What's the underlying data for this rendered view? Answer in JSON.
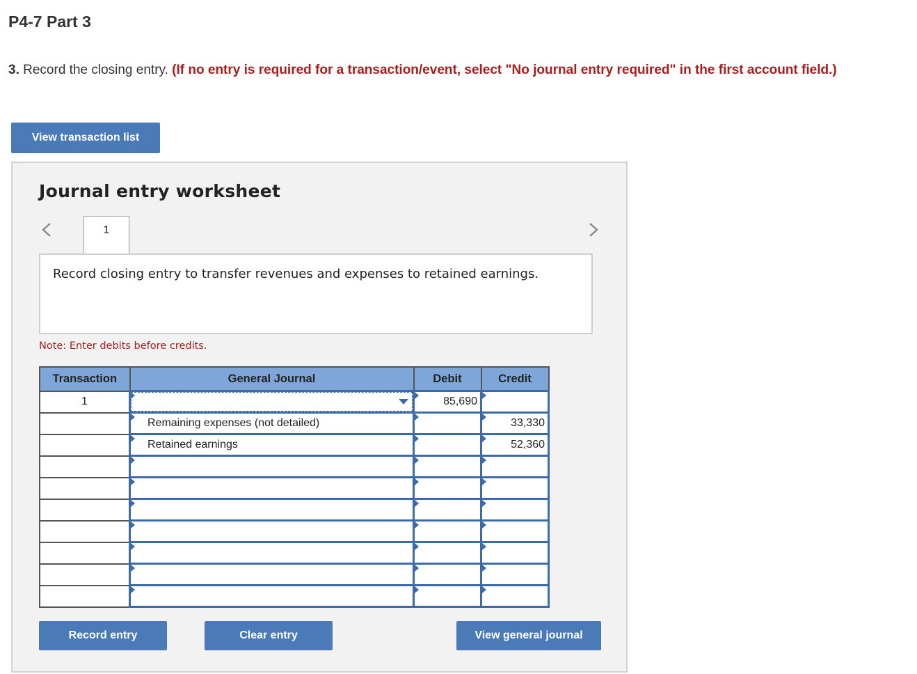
{
  "page": {
    "title": "P4-7 Part 3",
    "instruction_number": "3.",
    "instruction_text": "Record the closing entry.",
    "instruction_highlight": "(If no entry is required for a transaction/event, select \"No journal entry required\" in the first account field.)",
    "view_transaction_list_label": "View transaction list"
  },
  "worksheet": {
    "title": "Journal entry worksheet",
    "current_tab": "1",
    "description": "Record closing entry to transfer revenues and expenses to retained earnings.",
    "note": "Note: Enter debits before credits.",
    "columns": {
      "transaction": "Transaction",
      "general_journal": "General Journal",
      "debit": "Debit",
      "credit": "Credit"
    },
    "rows": [
      {
        "transaction": "1",
        "account": "",
        "debit": "85,690",
        "credit": ""
      },
      {
        "transaction": "",
        "account": "Remaining expenses (not detailed)",
        "debit": "",
        "credit": "33,330"
      },
      {
        "transaction": "",
        "account": "Retained earnings",
        "debit": "",
        "credit": "52,360"
      },
      {
        "transaction": "",
        "account": "",
        "debit": "",
        "credit": ""
      },
      {
        "transaction": "",
        "account": "",
        "debit": "",
        "credit": ""
      },
      {
        "transaction": "",
        "account": "",
        "debit": "",
        "credit": ""
      },
      {
        "transaction": "",
        "account": "",
        "debit": "",
        "credit": ""
      },
      {
        "transaction": "",
        "account": "",
        "debit": "",
        "credit": ""
      },
      {
        "transaction": "",
        "account": "",
        "debit": "",
        "credit": ""
      },
      {
        "transaction": "",
        "account": "",
        "debit": "",
        "credit": ""
      }
    ],
    "buttons": {
      "record": "Record entry",
      "clear": "Clear entry",
      "view_general_journal": "View general journal"
    }
  },
  "colors": {
    "accent": "#4a7ab8",
    "header": "#7ea6d8",
    "warning": "#a61d1d"
  }
}
